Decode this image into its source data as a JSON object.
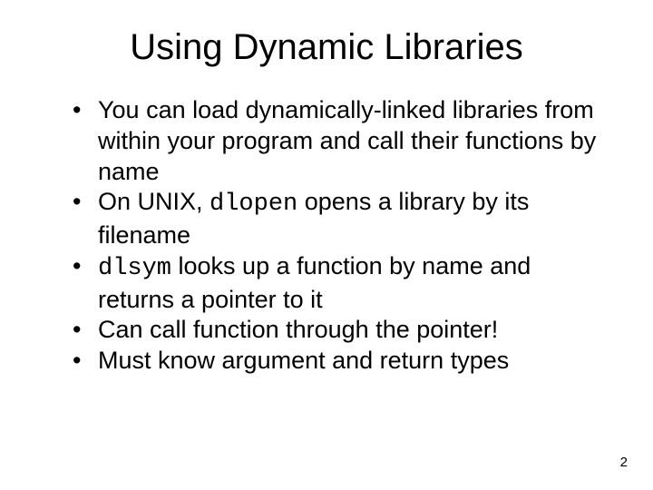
{
  "title": "Using Dynamic Libraries",
  "bullets": {
    "b1": "You can load dynamically-linked libraries from within your program and call their functions by name",
    "b2_pre": "On UNIX, ",
    "b2_code": "dlopen",
    "b2_post": " opens a library by its filename",
    "b3_code": "dlsym",
    "b3_post": " looks up a function by name and returns a pointer to it",
    "b4": "Can call function through the pointer!",
    "b5": "Must know argument and return types"
  },
  "page_number": "2"
}
